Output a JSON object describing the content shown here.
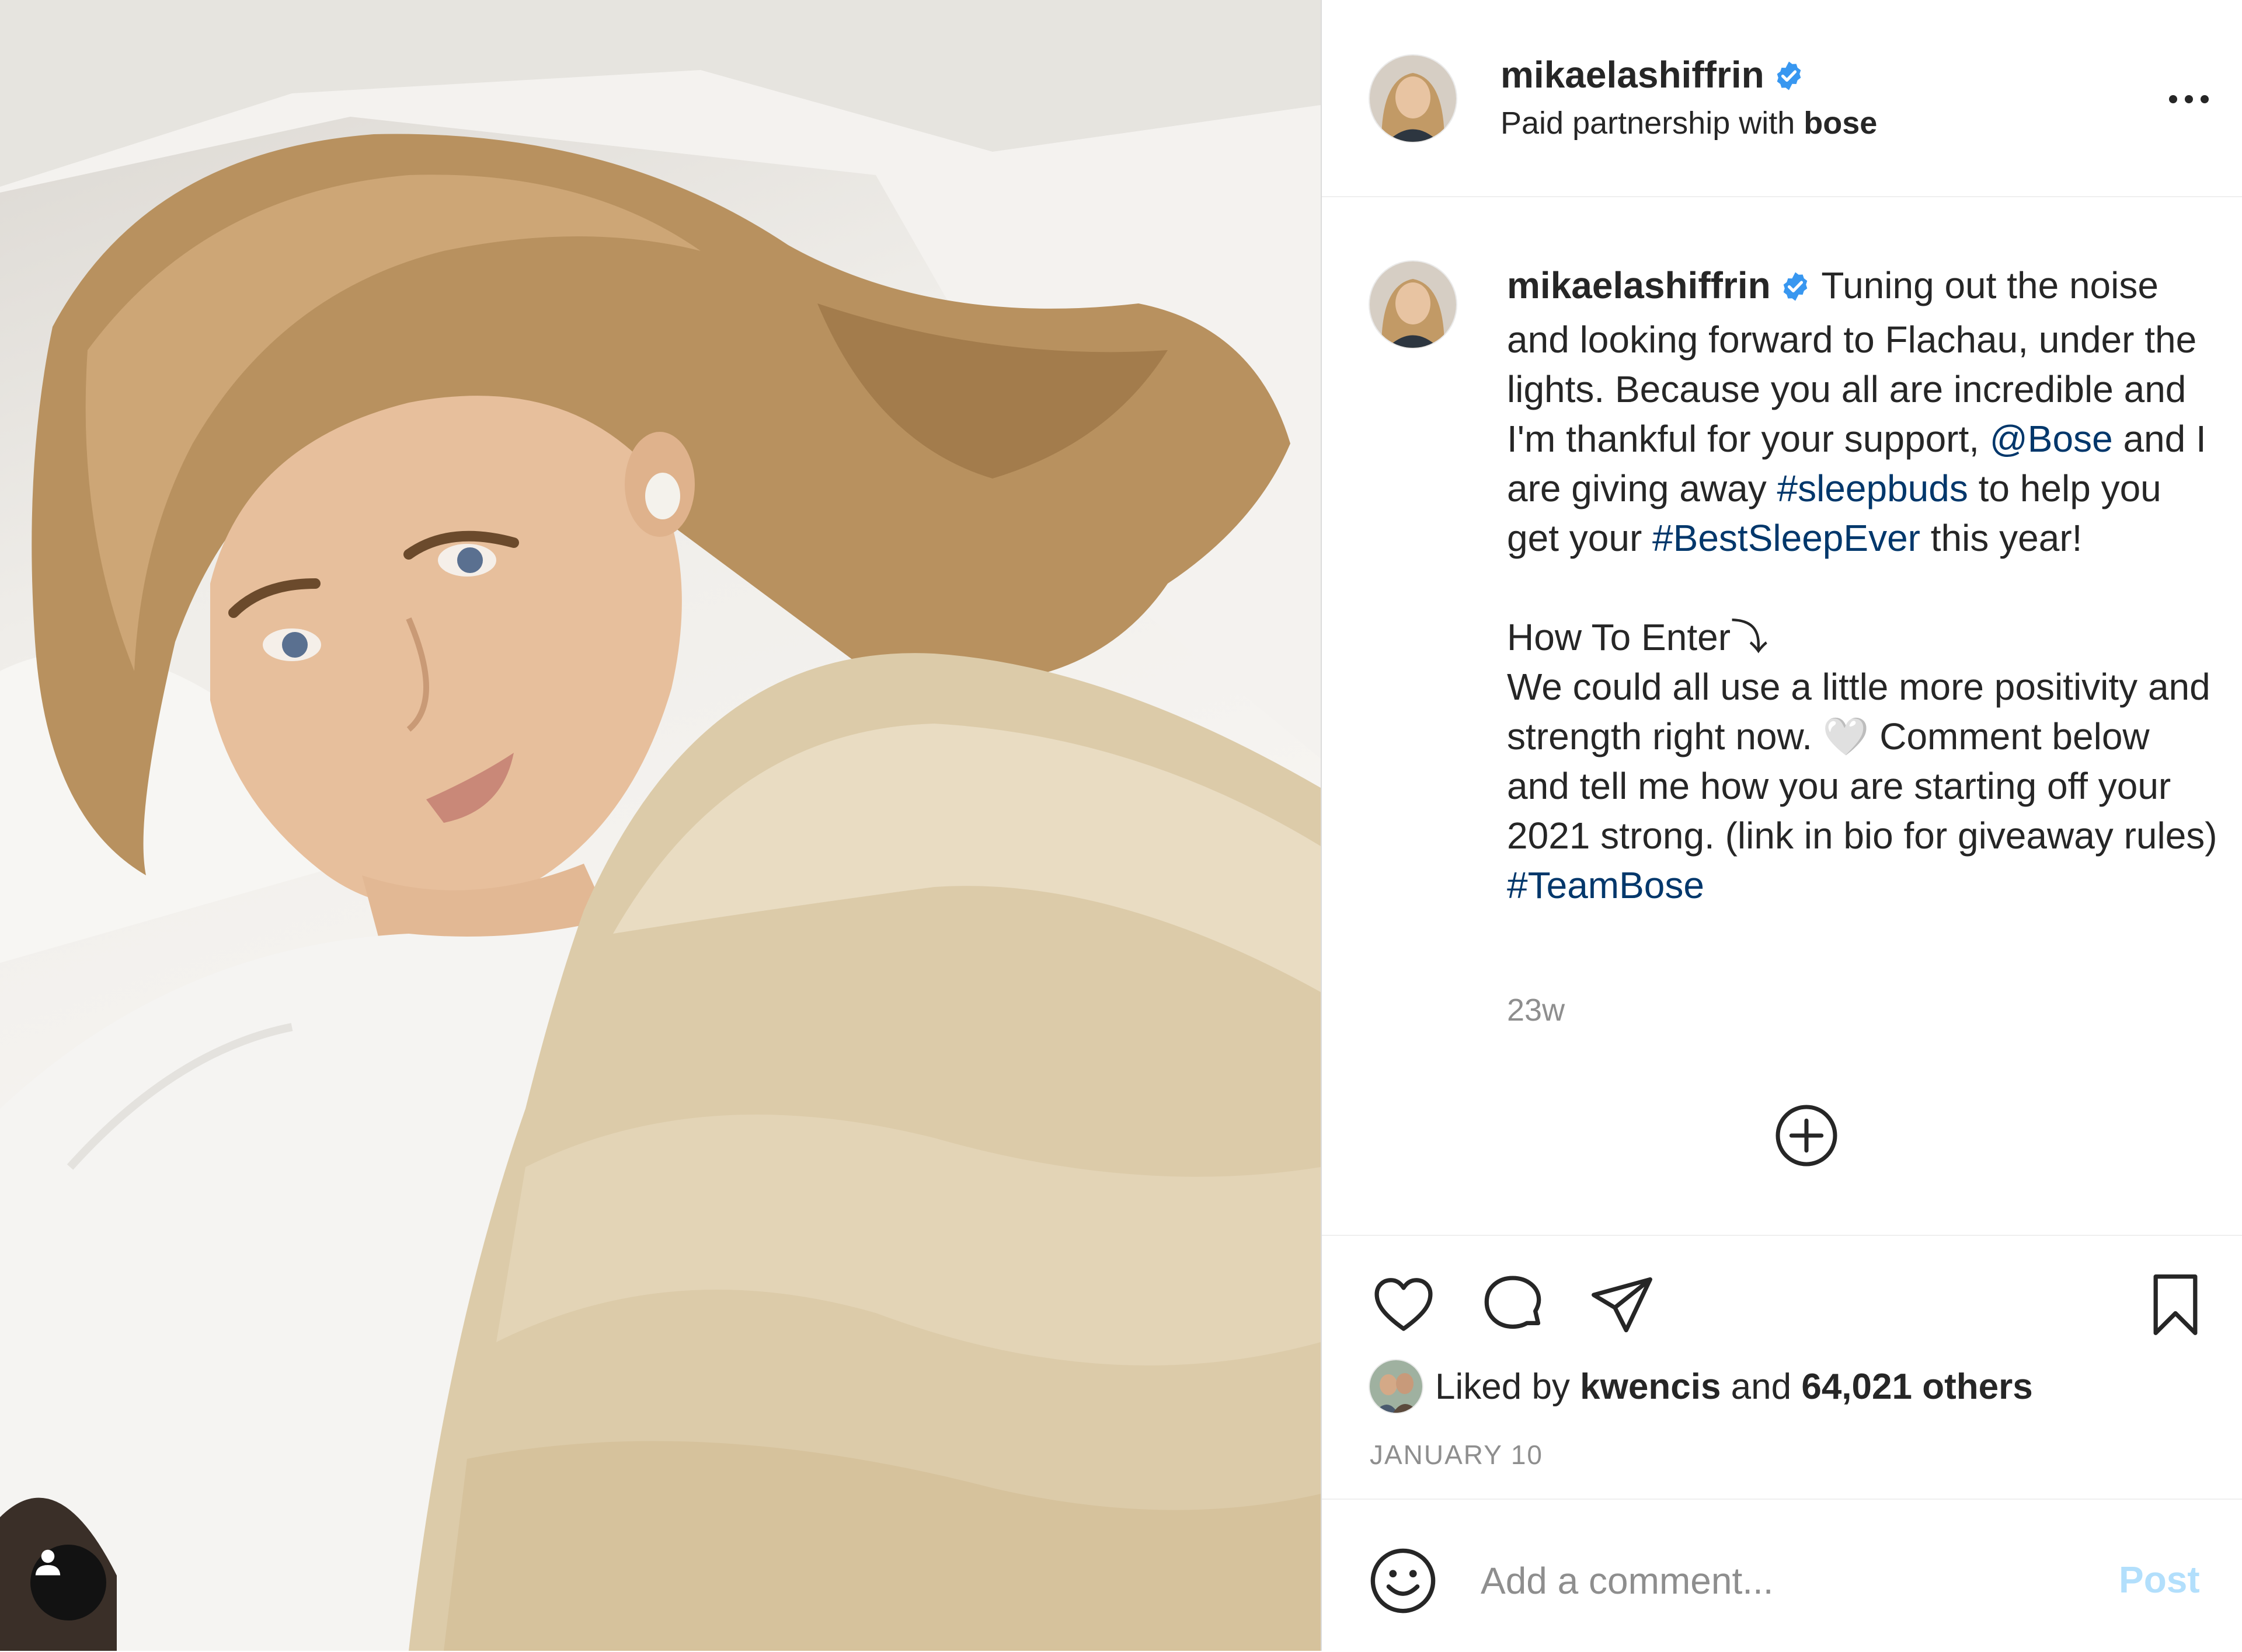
{
  "post": {
    "username": "mikaelashiffrin",
    "verified_icon": "verified-badge-icon",
    "partnership_prefix": "Paid partnership with",
    "partner": "bose",
    "more_icon": "more-options-icon"
  },
  "caption": {
    "username": "mikaelashiffrin",
    "text_1": "Tuning out the noise and looking forward to Flachau, under the lights. Because you all are incredible and I'm thankful for your support,",
    "mention": "@Bose",
    "text_2": "and I are giving away",
    "hashtag_1": "#sleepbuds",
    "text_3": "to help you get your",
    "hashtag_2": "#BestSleepEver",
    "text_4": "this year!",
    "how_to_enter": "How To Enter⤵",
    "text_5": "We could all use a little more positivity and strength right now. 🤍 Comment below and tell me how you are starting off your 2021 strong. (link in bio for giveaway rules)",
    "hashtag_3": "#TeamBose",
    "time_ago": "23w"
  },
  "actions": {
    "like_icon": "heart-icon",
    "comment_icon": "comment-bubble-icon",
    "share_icon": "paper-plane-icon",
    "save_icon": "bookmark-icon",
    "load_more_icon": "plus-circle-icon"
  },
  "likes": {
    "prefix": "Liked by",
    "user": "kwencis",
    "conjunction": "and",
    "others": "64,021 others"
  },
  "date": "JANUARY 10",
  "comment": {
    "placeholder": "Add a comment...",
    "post_label": "Post",
    "emoji_icon": "smiley-icon"
  },
  "photo": {
    "tag_icon": "user-tag-icon"
  },
  "colors": {
    "link": "#00376b",
    "verified": "#3897f0",
    "muted": "#8e8e8e",
    "post_disabled": "#b2dffc",
    "divider": "#efefef"
  }
}
